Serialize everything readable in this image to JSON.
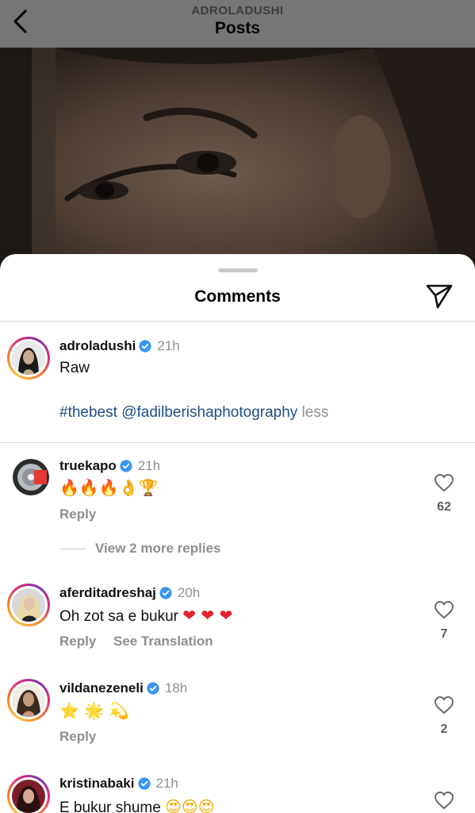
{
  "header": {
    "username": "ADROLADUSHI",
    "title": "Posts"
  },
  "sheet": {
    "title": "Comments"
  },
  "caption": {
    "username": "adroladushi",
    "time": "21h",
    "text": "Raw",
    "hashtag": "#thebest",
    "mention": "@fadilberishaphotography",
    "less": "less"
  },
  "comments": [
    {
      "username": "truekapo",
      "time": "21h",
      "text": "🔥🔥🔥👌🏆",
      "reply": "Reply",
      "likes": "62",
      "more_replies": "View 2 more replies"
    },
    {
      "username": "aferditadreshaj",
      "time": "20h",
      "text": "Oh zot sa e bukur",
      "emojis": "❤ ❤ ❤",
      "reply": "Reply",
      "see_translation": "See Translation",
      "likes": "7"
    },
    {
      "username": "vildanezeneli",
      "time": "18h",
      "text": "⭐ 🌟 💫",
      "reply": "Reply",
      "likes": "2"
    },
    {
      "username": "kristinabaki",
      "time": "21h",
      "text": "E bukur shume",
      "emojis": "😍😍😍"
    }
  ],
  "icons": [
    "back-chevron-icon",
    "send-icon",
    "verified-badge-icon",
    "heart-outline-icon"
  ],
  "colors": {
    "link": "#1d4f87",
    "muted": "#8e8e8e",
    "verified": "#3897f0",
    "ring": "#dd2a7b"
  }
}
